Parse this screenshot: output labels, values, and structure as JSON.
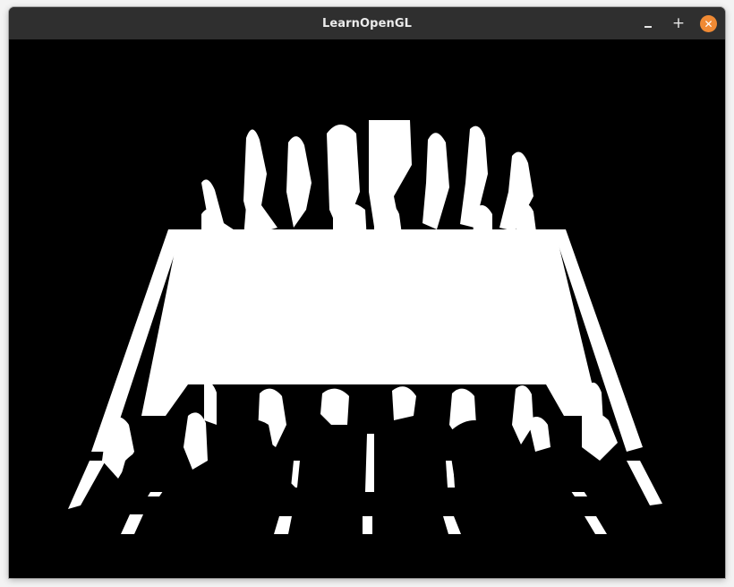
{
  "window": {
    "title": "LearnOpenGL",
    "controls": {
      "minimize_icon": "minimize-icon",
      "maximize_icon": "maximize-icon",
      "close_icon": "close-icon",
      "maximize_glyph": "+",
      "close_glyph": "✕"
    },
    "colors": {
      "titlebar": "#2f2f2f",
      "close_accent": "#f08a34",
      "viewport_background": "#000000",
      "foreground": "#ffffff"
    }
  },
  "render": {
    "description_icon": "opengl-render-output",
    "mode": "black-and-white"
  }
}
